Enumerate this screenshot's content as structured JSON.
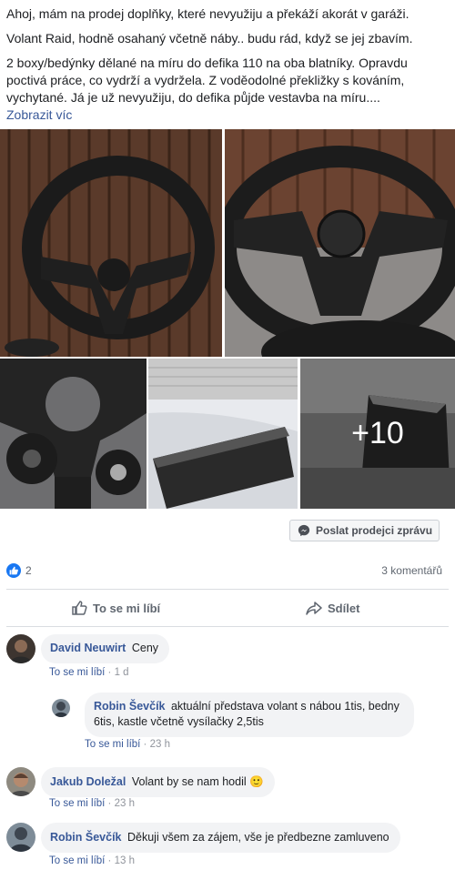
{
  "post": {
    "paragraphs": [
      "Ahoj, mám na prodej doplňky, které nevyužiju a překáží akorát v garáži.",
      "Volant Raid, hodně osahaný včetně náby.. budu rád, když se jej zbavím.",
      "2 boxy/bedýnky dělané na míru do defika 110 na oba blatníky. Opravdu poctivá práce, co vydrží a vydržela. Z voděodolné překližky s kováním, vychytané. Já je už nevyužiju, do defika půjde vestavba na míru...."
    ],
    "see_more": "Zobrazit víc"
  },
  "photos": {
    "more_count": "+10"
  },
  "message_button": {
    "label": "Poslat prodejci zprávu",
    "icon": "messenger-icon"
  },
  "reactions": {
    "count": "2",
    "comments": "3 komentářů"
  },
  "actions": {
    "like": "To se mi líbí",
    "share": "Sdílet"
  },
  "comments": [
    {
      "author": "David Neuwirt",
      "text": "Ceny",
      "like": "To se mi líbí",
      "sep": " · ",
      "time": "1 d"
    },
    {
      "author": "Robin Ševčík",
      "text": "aktuální představa volant s nábou 1tis, bedny 6tis, kastle včetně vysílačky 2,5tis",
      "like": "To se mi líbí",
      "sep": " · ",
      "time": "23 h"
    },
    {
      "author": "Jakub Doležal",
      "text": "Volant by se nam hodil",
      "emoji": "🙂",
      "like": "To se mi líbí",
      "sep": " · ",
      "time": "23 h"
    },
    {
      "author": "Robin Ševčík",
      "text": "Děkuji všem za zájem, vše je předbezne zamluveno",
      "like": "To se mi líbí",
      "sep": " · ",
      "time": "13 h"
    }
  ],
  "colors": {
    "link": "#385898",
    "like_blue": "#1877f2",
    "bubble": "#f2f3f5"
  }
}
